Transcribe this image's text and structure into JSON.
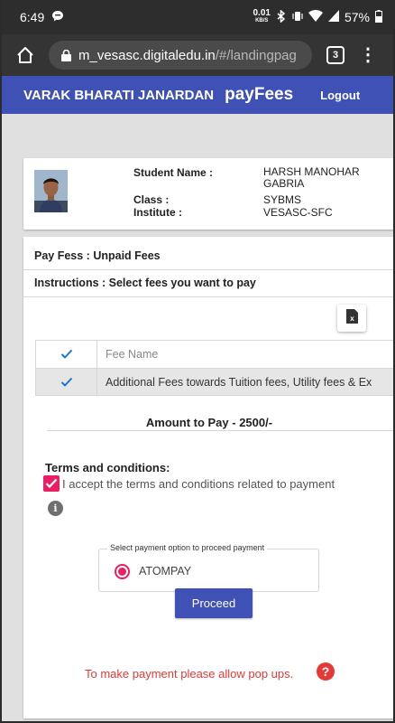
{
  "status_bar": {
    "time": "6:49",
    "net_speed": "0.01",
    "net_unit": "KB/S",
    "battery": "57%",
    "icons": [
      "chat-notification-icon",
      "bluetooth-icon",
      "vibrate-icon",
      "wifi-icon",
      "signal-icon",
      "battery-icon"
    ]
  },
  "browser": {
    "url_host": "m_vesasc.digitaledu.in",
    "url_path": "/#/landingpag",
    "tab_count": "3"
  },
  "app_header": {
    "institute": "VARAK BHARATI JANARDAN",
    "brand": "payFees",
    "logout": "Logout",
    "color": "#3f51b5"
  },
  "student": {
    "name_label": "Student Name :",
    "name_line1": "HARSH MANOHAR",
    "name_line2": "GABRIA",
    "class_label": "Class :",
    "class_value": "SYBMS",
    "institute_label": "Institute :",
    "institute_value": "VESASC-SFC"
  },
  "fees": {
    "title": "Pay Fess : Unpaid Fees",
    "instructions": "Instructions : Select fees you want to pay",
    "table_header": "Fee Name",
    "rows": [
      {
        "name": "Additional Fees towards Tuition fees, Utility fees & Ex",
        "checked": true
      }
    ],
    "amount": "Amount to Pay - 2500/-"
  },
  "terms": {
    "title": "Terms and conditions:",
    "accept_text": "I accept the terms and conditions related to payment",
    "accent": "#e91e63"
  },
  "payment": {
    "legend": "Select payment option to proceed payment",
    "option": "ATOMPAY",
    "proceed": "Proceed",
    "popup_note": "To make payment please allow pop ups.",
    "note_color": "#e53935"
  }
}
